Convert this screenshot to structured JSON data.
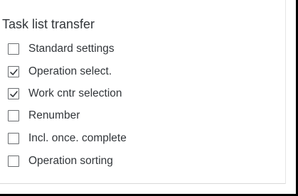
{
  "group": {
    "title": "Task list transfer",
    "options": [
      {
        "label": "Standard settings",
        "checked": false
      },
      {
        "label": "Operation select.",
        "checked": true
      },
      {
        "label": "Work cntr selection",
        "checked": true
      },
      {
        "label": "Renumber",
        "checked": false
      },
      {
        "label": "Incl. once. complete",
        "checked": false
      },
      {
        "label": "Operation sorting",
        "checked": false
      }
    ]
  },
  "icons": {
    "checked": "checkmark-icon"
  }
}
